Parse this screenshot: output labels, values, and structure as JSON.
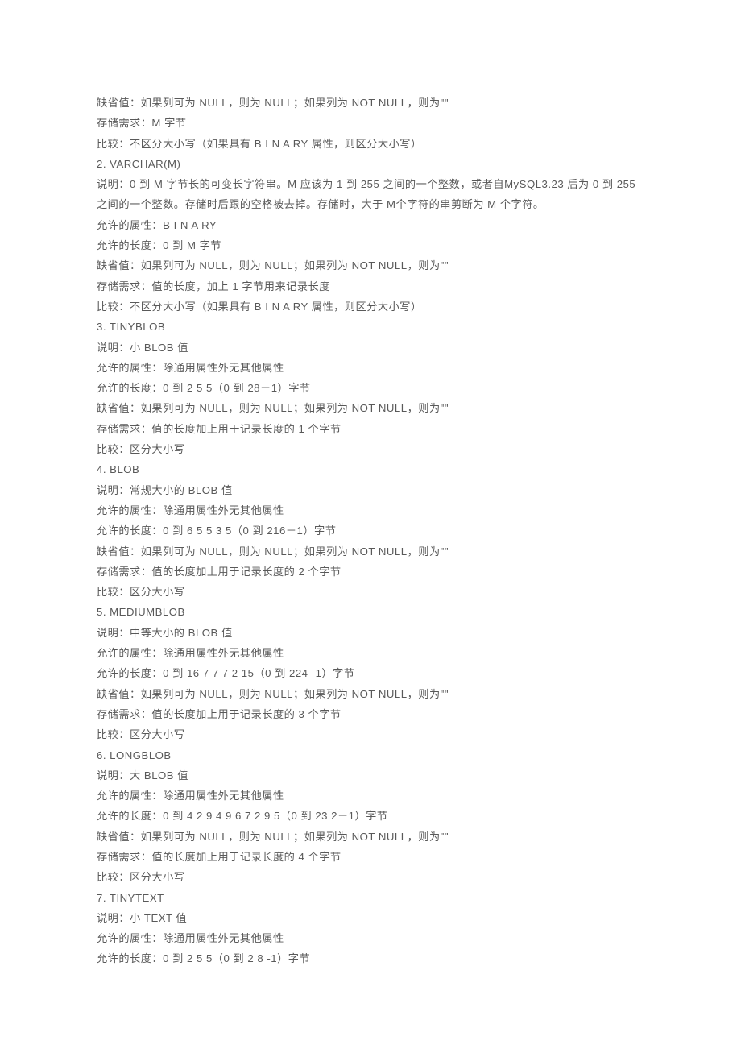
{
  "lines": [
    "缺省值：如果列可为 NULL，则为 NULL；如果列为 NOT NULL，则为\"\"",
    "存储需求：M 字节",
    "比较：不区分大小写（如果具有 B I N A RY 属性，则区分大小写）",
    "2. VARCHAR(M)",
    "说明：0 到 M 字节长的可变长字符串。M 应该为 1 到 255 之间的一个整数，或者自MySQL3.23 后为 0 到 255 之间的一个整数。存储时后跟的空格被去掉。存储时，大于 M个字符的串剪断为 M 个字符。",
    "允许的属性：B I N A RY",
    "允许的长度：0 到 M 字节",
    "缺省值：如果列可为 NULL，则为 NULL；如果列为 NOT NULL，则为\"\"",
    "存储需求：值的长度，加上 1 字节用来记录长度",
    "比较：不区分大小写（如果具有 B I N A RY 属性，则区分大小写）",
    "3. TINYBLOB",
    "说明：小 BLOB 值",
    "允许的属性：除通用属性外无其他属性",
    "允许的长度：0 到 2 5 5（0 到 28－1）字节",
    "缺省值：如果列可为 NULL，则为 NULL；如果列为 NOT NULL，则为\"\"",
    "存储需求：值的长度加上用于记录长度的 1 个字节",
    "比较：区分大小写",
    "4. BLOB",
    "说明：常规大小的 BLOB 值",
    "允许的属性：除通用属性外无其他属性",
    "允许的长度：0 到 6 5 5 3 5（0 到 216－1）字节",
    "缺省值：如果列可为 NULL，则为 NULL；如果列为 NOT NULL，则为\"\"",
    "存储需求：值的长度加上用于记录长度的 2 个字节",
    "比较：区分大小写",
    "5. MEDIUMBLOB",
    "说明：中等大小的 BLOB 值",
    "允许的属性：除通用属性外无其他属性",
    "允许的长度：0 到 16 7 7 7 2 15（0 到 224 -1）字节",
    "缺省值：如果列可为 NULL，则为 NULL；如果列为 NOT NULL，则为\"\"",
    "存储需求：值的长度加上用于记录长度的 3 个字节",
    "比较：区分大小写",
    "6. LONGBLOB",
    "说明：大 BLOB 值",
    "允许的属性：除通用属性外无其他属性",
    "允许的长度：0 到 4 2 9 4 9 6 7 2 9 5（0 到 23 2－1）字节",
    "缺省值：如果列可为 NULL，则为 NULL；如果列为 NOT NULL，则为\"\"",
    "存储需求：值的长度加上用于记录长度的 4 个字节",
    "比较：区分大小写",
    "7. TINYTEXT",
    "说明：小 TEXT 值",
    "允许的属性：除通用属性外无其他属性",
    "允许的长度：0 到 2 5 5（0 到 2 8 -1）字节"
  ]
}
